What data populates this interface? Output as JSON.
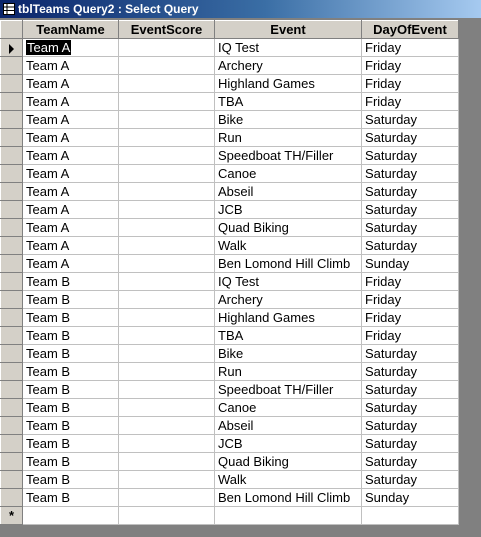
{
  "window": {
    "title": "tblTeams Query2 : Select Query"
  },
  "grid": {
    "columns": [
      "TeamName",
      "EventScore",
      "Event",
      "DayOfEvent"
    ],
    "rows": [
      {
        "team": "Team A",
        "score": "",
        "event": "IQ Test",
        "day": "Friday"
      },
      {
        "team": "Team A",
        "score": "",
        "event": "Archery",
        "day": "Friday"
      },
      {
        "team": "Team A",
        "score": "",
        "event": "Highland Games",
        "day": "Friday"
      },
      {
        "team": "Team A",
        "score": "",
        "event": "TBA",
        "day": "Friday"
      },
      {
        "team": "Team A",
        "score": "",
        "event": "Bike",
        "day": "Saturday"
      },
      {
        "team": "Team A",
        "score": "",
        "event": "Run",
        "day": "Saturday"
      },
      {
        "team": "Team A",
        "score": "",
        "event": "Speedboat TH/Filler",
        "day": "Saturday"
      },
      {
        "team": "Team A",
        "score": "",
        "event": "Canoe",
        "day": "Saturday"
      },
      {
        "team": "Team A",
        "score": "",
        "event": "Abseil",
        "day": "Saturday"
      },
      {
        "team": "Team A",
        "score": "",
        "event": "JCB",
        "day": "Saturday"
      },
      {
        "team": "Team A",
        "score": "",
        "event": "Quad Biking",
        "day": "Saturday"
      },
      {
        "team": "Team A",
        "score": "",
        "event": "Walk",
        "day": "Saturday"
      },
      {
        "team": "Team A",
        "score": "",
        "event": "Ben Lomond Hill Climb",
        "day": "Sunday"
      },
      {
        "team": "Team B",
        "score": "",
        "event": "IQ Test",
        "day": "Friday"
      },
      {
        "team": "Team B",
        "score": "",
        "event": "Archery",
        "day": "Friday"
      },
      {
        "team": "Team B",
        "score": "",
        "event": "Highland Games",
        "day": "Friday"
      },
      {
        "team": "Team B",
        "score": "",
        "event": "TBA",
        "day": "Friday"
      },
      {
        "team": "Team B",
        "score": "",
        "event": "Bike",
        "day": "Saturday"
      },
      {
        "team": "Team B",
        "score": "",
        "event": "Run",
        "day": "Saturday"
      },
      {
        "team": "Team B",
        "score": "",
        "event": "Speedboat TH/Filler",
        "day": "Saturday"
      },
      {
        "team": "Team B",
        "score": "",
        "event": "Canoe",
        "day": "Saturday"
      },
      {
        "team": "Team B",
        "score": "",
        "event": "Abseil",
        "day": "Saturday"
      },
      {
        "team": "Team B",
        "score": "",
        "event": "JCB",
        "day": "Saturday"
      },
      {
        "team": "Team B",
        "score": "",
        "event": "Quad Biking",
        "day": "Saturday"
      },
      {
        "team": "Team B",
        "score": "",
        "event": "Walk",
        "day": "Saturday"
      },
      {
        "team": "Team B",
        "score": "",
        "event": "Ben Lomond Hill Climb",
        "day": "Sunday"
      }
    ],
    "new_row_marker": "*",
    "current_row_icon": "current-record-arrow-icon"
  }
}
